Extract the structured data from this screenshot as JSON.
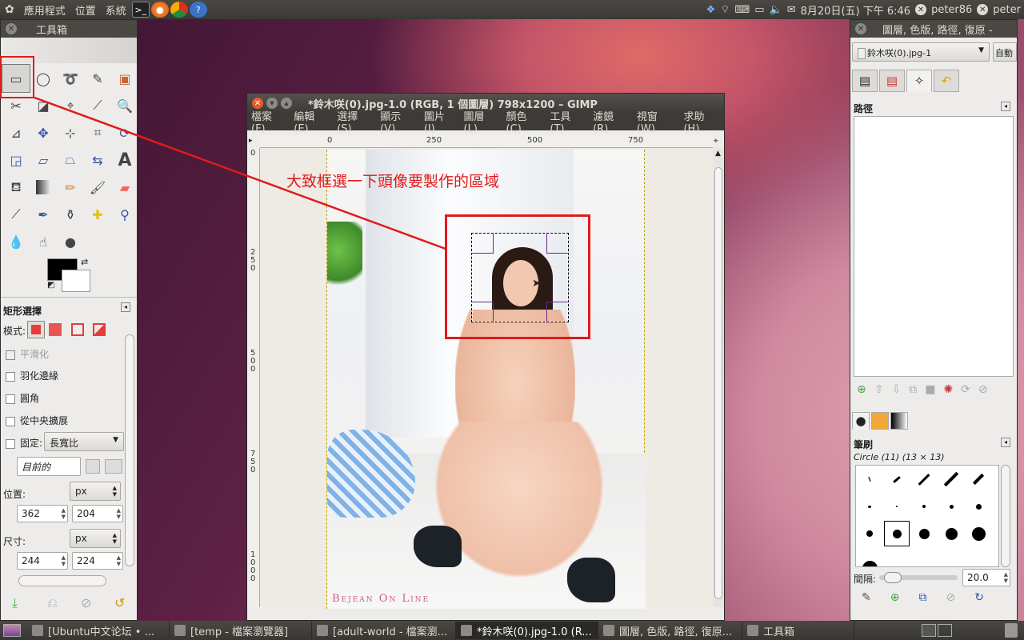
{
  "top_panel": {
    "applications": "應用程式",
    "places": "位置",
    "system": "系統",
    "clock": "8月20日(五) 下午 6:46",
    "user": "peter86",
    "user_short": "peter"
  },
  "toolbox": {
    "title": "工具箱",
    "options_title": "矩形選擇",
    "mode_label": "模式:",
    "antialias": "平滑化",
    "feather": "羽化邊緣",
    "rounded": "圓角",
    "expand_center": "從中央擴展",
    "fixed": "固定:",
    "fixed_value": "長寬比",
    "current": "目前的",
    "position_label": "位置:",
    "unit": "px",
    "pos_x": "362",
    "pos_y": "204",
    "size_label": "尺寸:",
    "size_w": "244",
    "size_h": "224"
  },
  "gimp": {
    "title": "*鈴木咲(0).jpg-1.0 (RGB, 1 個圖層) 798x1200 – GIMP",
    "menus": [
      "檔案(F)",
      "編輯(E)",
      "選擇(S)",
      "顯示(V)",
      "圖片(I)",
      "圖層(L)",
      "顏色(C)",
      "工具(T)",
      "濾鏡(R)",
      "視窗(W)",
      "求助(H)"
    ],
    "ruler_h": [
      "0",
      "250",
      "500",
      "750"
    ],
    "ruler_v": [
      "0",
      "2\n5\n0",
      "5\n0\n0",
      "7\n5\n0",
      "1\n0\n0\n0"
    ],
    "annotation": "大致框選一下頭像要製作的區域",
    "watermark": "Bejean On Line"
  },
  "layers": {
    "title": "圖層, 色版, 路徑, 復原 -",
    "image_select": "鈴木咲(0).jpg-1",
    "auto": "自動",
    "paths_title": "路徑",
    "brushes_title": "筆刷",
    "brush_name": "Circle (11) (13 × 13)",
    "spacing_label": "間隔:",
    "spacing_value": "20.0"
  },
  "taskbar": [
    {
      "label": "[Ubuntu中文论坛 • ...",
      "active": false
    },
    {
      "label": "[temp - 檔案瀏覽器]",
      "active": false
    },
    {
      "label": "[adult-world - 檔案瀏...",
      "active": false
    },
    {
      "label": "*鈴木咲(0).jpg-1.0 (R...",
      "active": true
    },
    {
      "label": "圖層, 色版, 路徑, 復原...",
      "active": false
    },
    {
      "label": "工具箱",
      "active": false
    }
  ],
  "colors": {
    "annotation": "#e01b1b",
    "panel": "#3c3b37",
    "close": "#e55b2c"
  }
}
